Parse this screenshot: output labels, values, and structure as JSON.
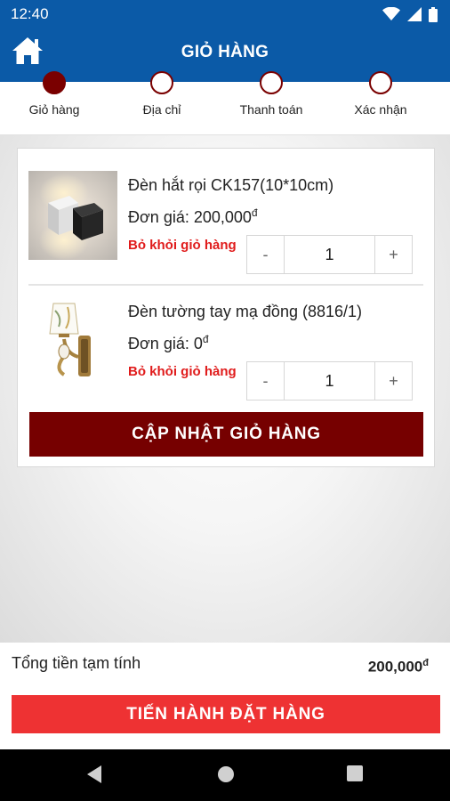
{
  "status_bar": {
    "time": "12:40"
  },
  "app_bar": {
    "title": "GIỎ HÀNG"
  },
  "steps": [
    {
      "label": "Giỏ hàng",
      "active": true
    },
    {
      "label": "Địa chỉ",
      "active": false
    },
    {
      "label": "Thanh toán",
      "active": false
    },
    {
      "label": "Xác nhận",
      "active": false
    }
  ],
  "cart": {
    "items": [
      {
        "name": "Đèn hắt rọi CK157(10*10cm)",
        "price_label": "Đơn giá: ",
        "price": "200,000",
        "currency": "đ",
        "remove_label": "Bỏ khỏi giỏ hàng",
        "quantity": "1",
        "minus_label": "-",
        "plus_label": "+"
      },
      {
        "name": "Đèn tường tay mạ đồng (8816/1)",
        "price_label": "Đơn giá: ",
        "price": "0",
        "currency": "đ",
        "remove_label": "Bỏ khỏi giỏ hàng",
        "quantity": "1",
        "minus_label": "-",
        "plus_label": "+"
      }
    ],
    "update_button": "CẬP NHẬT GIỎ HÀNG"
  },
  "footer": {
    "subtotal_label": "Tổng tiền tạm tính",
    "subtotal_value": "200,000",
    "currency": "đ",
    "checkout_button": "TIẾN HÀNH ĐẶT HÀNG"
  },
  "colors": {
    "brand_blue": "#0b5aa7",
    "dark_red": "#760000",
    "remove_red": "#e01b1b",
    "checkout_red": "#ee3233"
  },
  "icons": {
    "home": "home-icon",
    "wifi": "wifi-icon",
    "signal": "signal-icon",
    "battery": "battery-icon",
    "nav_back": "back-icon",
    "nav_home": "home-circle-icon",
    "nav_recents": "recents-icon"
  }
}
